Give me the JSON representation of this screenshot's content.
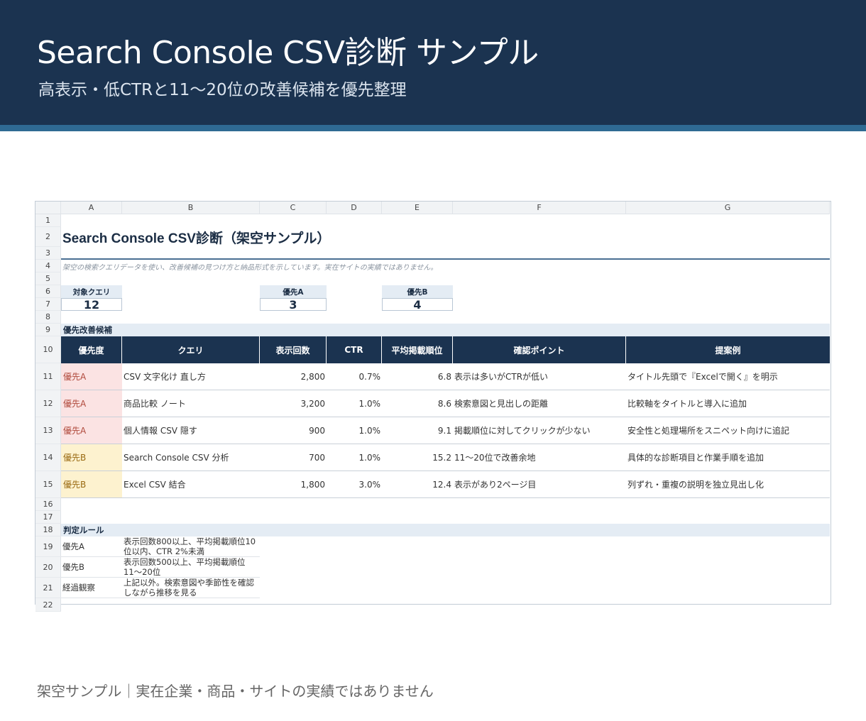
{
  "banner": {
    "title": "Search Console CSV診断 サンプル",
    "subtitle": "高表示・低CTRと11〜20位の改善候補を優先整理"
  },
  "sheet": {
    "columns": [
      "A",
      "B",
      "C",
      "D",
      "E",
      "F",
      "G"
    ],
    "row_numbers": [
      "1",
      "2",
      "3",
      "4",
      "5",
      "6",
      "7",
      "8",
      "9",
      "10",
      "11",
      "12",
      "13",
      "14",
      "15",
      "16",
      "17",
      "18",
      "19",
      "20",
      "21",
      "22"
    ],
    "title": "Search Console CSV診断（架空サンプル）",
    "note": "架空の検索クエリデータを使い、改善候補の見つけ方と納品形式を示しています。実在サイトの実績ではありません。",
    "kpis": [
      {
        "label": "対象クエリ",
        "value": "12"
      },
      {
        "label": "優先A",
        "value": "3"
      },
      {
        "label": "優先B",
        "value": "4"
      }
    ],
    "section_candidates": "優先改善候補",
    "table_headers": [
      "優先度",
      "クエリ",
      "表示回数",
      "CTR",
      "平均掲載順位",
      "確認ポイント",
      "提案例"
    ],
    "rows": [
      {
        "priority": "優先A",
        "query": "CSV 文字化け 直し方",
        "impressions": "2,800",
        "ctr": "0.7%",
        "position": "6.8",
        "check": "表示は多いがCTRが低い",
        "proposal": "タイトル先頭で『Excelで開く』を明示"
      },
      {
        "priority": "優先A",
        "query": "商品比較 ノート",
        "impressions": "3,200",
        "ctr": "1.0%",
        "position": "8.6",
        "check": "検索意図と見出しの距離",
        "proposal": "比較軸をタイトルと導入に追加"
      },
      {
        "priority": "優先A",
        "query": "個人情報 CSV 隠す",
        "impressions": "900",
        "ctr": "1.0%",
        "position": "9.1",
        "check": "掲載順位に対してクリックが少ない",
        "proposal": "安全性と処理場所をスニペット向けに追記"
      },
      {
        "priority": "優先B",
        "query": "Search Console CSV 分析",
        "impressions": "700",
        "ctr": "1.0%",
        "position": "15.2",
        "check": "11〜20位で改善余地",
        "proposal": "具体的な診断項目と作業手順を追加"
      },
      {
        "priority": "優先B",
        "query": "Excel CSV 結合",
        "impressions": "1,800",
        "ctr": "3.0%",
        "position": "12.4",
        "check": "表示があり2ページ目",
        "proposal": "列ずれ・重複の説明を独立見出し化"
      }
    ],
    "section_rules": "判定ルール",
    "rules": [
      {
        "label": "優先A",
        "text": "表示回数800以上、平均掲載順位10位以内、CTR 2%未満"
      },
      {
        "label": "優先B",
        "text": "表示回数500以上、平均掲載順位11〜20位"
      },
      {
        "label": "経過観察",
        "text": "上記以外。検索意図や季節性を確認しながら推移を見る"
      }
    ]
  },
  "footer": "架空サンプル｜実在企業・商品・サイトの実績ではありません",
  "colors": {
    "banner": "#1b3350",
    "stripe": "#2f6a93",
    "priorityA_bg": "#fbe3e3",
    "priorityB_bg": "#fdf2cf"
  }
}
